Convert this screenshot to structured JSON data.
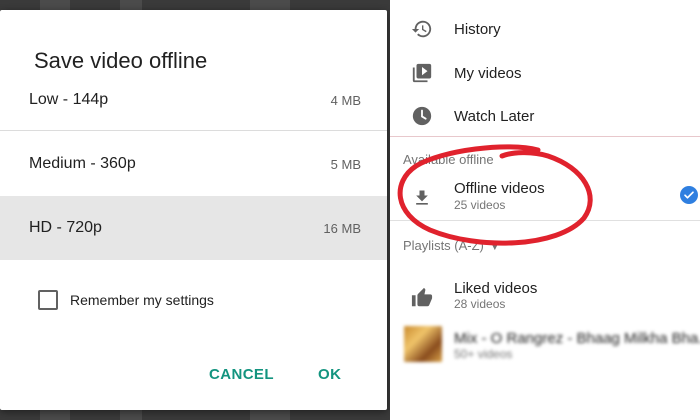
{
  "dialog": {
    "title": "Save video offline",
    "options": [
      {
        "label": "Low - 144p",
        "size": "4 MB",
        "selected": false
      },
      {
        "label": "Medium - 360p",
        "size": "5 MB",
        "selected": false
      },
      {
        "label": "HD - 720p",
        "size": "16 MB",
        "selected": true
      }
    ],
    "remember_label": "Remember my settings",
    "remember_checked": false,
    "cancel_label": "CANCEL",
    "ok_label": "OK",
    "accent_color": "#13947f"
  },
  "library": {
    "items": [
      {
        "label": "History",
        "icon": "history-icon"
      },
      {
        "label": "My videos",
        "icon": "my-videos-icon"
      },
      {
        "label": "Watch Later",
        "icon": "clock-icon"
      }
    ],
    "available_offline_header": "Available offline",
    "offline": {
      "label": "Offline videos",
      "sub": "25 videos",
      "icon": "download-icon",
      "badge_icon": "check-circle-icon",
      "badge_color": "#2f7fe0"
    },
    "playlists_header": "Playlists (A-Z)",
    "playlists": [
      {
        "label": "Liked videos",
        "sub": "28 videos",
        "icon": "thumbs-up-icon"
      },
      {
        "label": "Mix - O Rangrez - Bhaag Milkha Bha...",
        "sub": "50+ videos",
        "icon": "playlist-thumbnail"
      }
    ]
  },
  "annotation": {
    "color": "#e0222d"
  }
}
